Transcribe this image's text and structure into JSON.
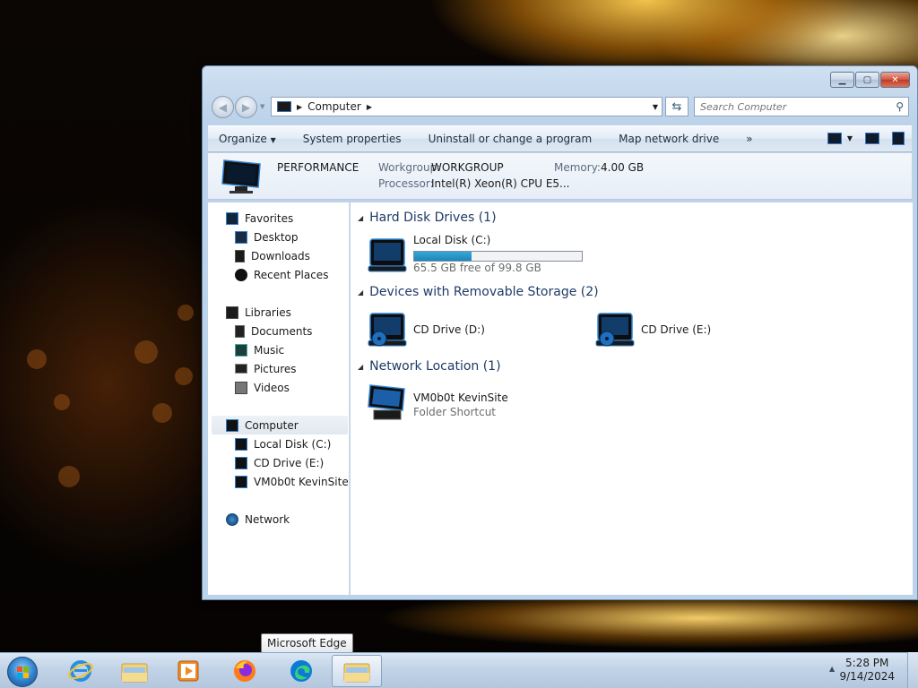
{
  "window": {
    "address": {
      "location": "Computer"
    },
    "search": {
      "placeholder": "Search Computer"
    }
  },
  "toolbar": {
    "organize": "Organize",
    "system_properties": "System properties",
    "uninstall": "Uninstall or change a program",
    "map_drive": "Map network drive",
    "more": "»"
  },
  "details": {
    "name": "PERFORMANCE",
    "workgroup_label": "Workgroup:",
    "workgroup_value": "WORKGROUP",
    "memory_label": "Memory:",
    "memory_value": "4.00 GB",
    "processor_label": "Processor:",
    "processor_value": "Intel(R) Xeon(R) CPU E5..."
  },
  "nav": {
    "favorites": "Favorites",
    "desktop": "Desktop",
    "downloads": "Downloads",
    "recent_places": "Recent Places",
    "libraries": "Libraries",
    "documents": "Documents",
    "music": "Music",
    "pictures": "Pictures",
    "videos": "Videos",
    "computer": "Computer",
    "local_disk": "Local Disk (C:)",
    "cd_drive_e": "CD Drive (E:)",
    "kevinsite": "VM0b0t KevinSite",
    "network": "Network"
  },
  "content": {
    "hdd_header": "Hard Disk Drives (1)",
    "local_disk_name": "Local Disk (C:)",
    "local_disk_free": "65.5 GB free of 99.8 GB",
    "local_disk_used_fraction": 0.34,
    "removable_header": "Devices with Removable Storage (2)",
    "cd_d": "CD Drive (D:)",
    "cd_e": "CD Drive (E:)",
    "network_header": "Network Location (1)",
    "net_name": "VM0b0t KevinSite",
    "net_type": "Folder Shortcut"
  },
  "taskbar": {
    "tooltip": "Microsoft Edge",
    "time": "5:28 PM",
    "date": "9/14/2024"
  },
  "colors": {
    "accent_blue": "#1e3a66",
    "progress_fill": "#26a0da"
  }
}
